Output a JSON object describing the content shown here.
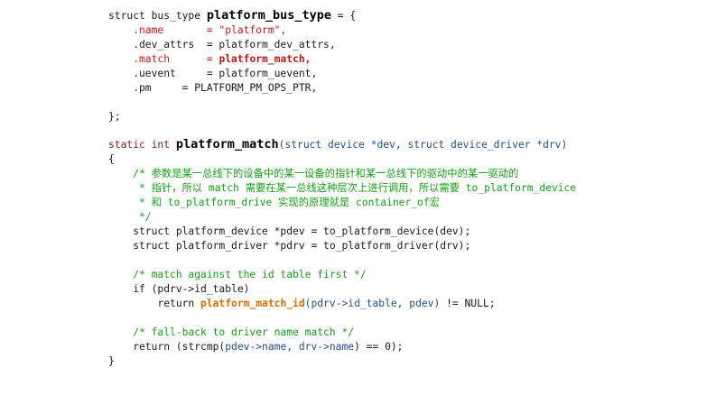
{
  "code": {
    "lines": [
      [
        {
          "t": "struct bus_type ",
          "c": "plain"
        },
        {
          "t": "platform_bus_type",
          "c": "big"
        },
        {
          "t": " = {",
          "c": "plain"
        }
      ],
      [
        {
          "t": "    .name       = \"platform\",",
          "c": "red"
        }
      ],
      [
        {
          "t": "    .dev_attrs  = platform_dev_attrs,",
          "c": "plain"
        }
      ],
      [
        {
          "t": "    .match      = ",
          "c": "red"
        },
        {
          "t": "platform_match,",
          "c": "redb"
        }
      ],
      [
        {
          "t": "    .uevent     = platform_uevent,",
          "c": "plain"
        }
      ],
      [
        {
          "t": "    .pm     = PLATFORM_PM_OPS_PTR,",
          "c": "plain"
        }
      ],
      [],
      [
        {
          "t": "};",
          "c": "plain"
        }
      ],
      [],
      [
        {
          "t": "static int ",
          "c": "kw"
        },
        {
          "t": "platform_match",
          "c": "big"
        },
        {
          "t": "(struct device *dev, struct device_driver *drv)",
          "c": "param"
        }
      ],
      [
        {
          "t": "{",
          "c": "plain"
        }
      ],
      [
        {
          "t": "    /* 参数是某一总线下的设备中的某一设备的指针和某一总线下的驱动中的某一驱动的",
          "c": "comment"
        }
      ],
      [
        {
          "t": "     * 指针，所以 match 需要在某一总线这种层次上进行调用，所以需要 to_platform_device",
          "c": "comment"
        }
      ],
      [
        {
          "t": "     * 和 to_platform_drive 实现的原理就是 container_of宏",
          "c": "comment"
        }
      ],
      [
        {
          "t": "     */",
          "c": "comment"
        }
      ],
      [
        {
          "t": "    struct platform_device *pdev = to_platform_device(dev);",
          "c": "plain"
        }
      ],
      [
        {
          "t": "    struct platform_driver *pdrv = to_platform_driver(drv);",
          "c": "plain"
        }
      ],
      [],
      [
        {
          "t": "    /* match against the id table first */",
          "c": "comment"
        }
      ],
      [
        {
          "t": "    if (pdrv->id_table)",
          "c": "plain"
        }
      ],
      [
        {
          "t": "        return ",
          "c": "plain"
        },
        {
          "t": "platform_match_id",
          "c": "orange"
        },
        {
          "t": "(pdrv->id_table, pdev)",
          "c": "param"
        },
        {
          "t": " != NULL;",
          "c": "plain"
        }
      ],
      [],
      [
        {
          "t": "    /* fall-back to driver name match */",
          "c": "comment"
        }
      ],
      [
        {
          "t": "    return (strcmp(",
          "c": "plain"
        },
        {
          "t": "pdev->name, drv->name",
          "c": "param"
        },
        {
          "t": ") == 0);",
          "c": "plain"
        }
      ],
      [
        {
          "t": "}",
          "c": "plain"
        }
      ]
    ]
  }
}
